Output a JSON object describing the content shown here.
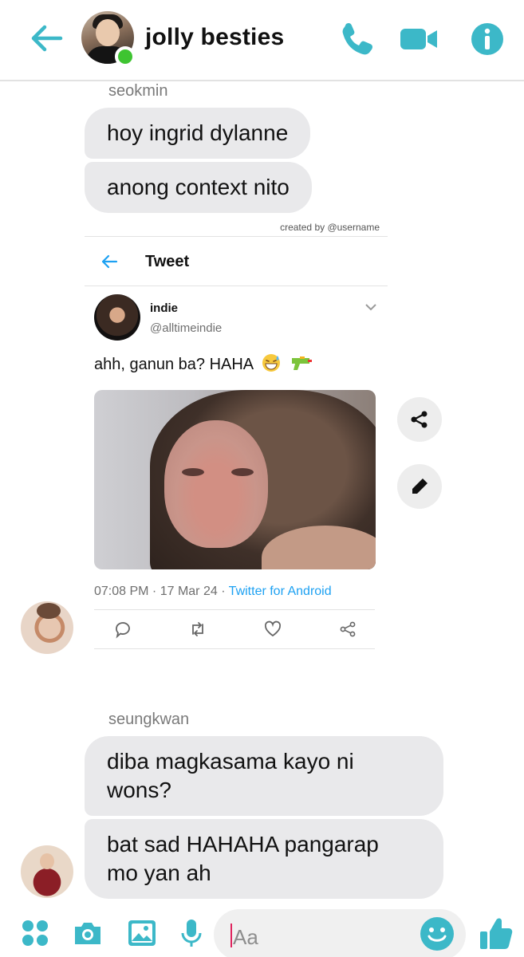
{
  "colors": {
    "accent": "#3cb8c8",
    "bubble": "#e9e9eb",
    "online": "#3ec431",
    "twitter_blue": "#1da1f2"
  },
  "header": {
    "title": "jolly besties",
    "icons": [
      "back-arrow-icon",
      "phone-icon",
      "video-icon",
      "info-icon"
    ]
  },
  "messages": [
    {
      "sender": "seokmin",
      "bubbles": [
        "hoy ingrid dylanne",
        "anong context nito"
      ]
    },
    {
      "sender": "seungkwan",
      "bubbles": [
        "diba magkasama kayo ni\nwons?",
        "bat sad HAHAHA pangarap\nmo yan ah"
      ]
    }
  ],
  "tweet_card": {
    "credit": "created by @username",
    "header_title": "Tweet",
    "author_name": "indie",
    "author_handle": "@alltimeindie",
    "text": "ahh, ganun ba? HAHA",
    "emojis": [
      "grinning-sweat-emoji",
      "water-pistol-emoji"
    ],
    "meta_time": "07:08 PM · 17 Mar 24 · ",
    "meta_source": "Twitter for Android",
    "actions": [
      "reply-icon",
      "retweet-icon",
      "like-icon",
      "share-icon"
    ]
  },
  "side_buttons": [
    "share-icon",
    "pencil-icon"
  ],
  "composer": {
    "placeholder": "Aa",
    "icons": [
      "apps-icon",
      "camera-icon",
      "gallery-icon",
      "microphone-icon",
      "emoji-icon",
      "like-thumb-icon"
    ]
  }
}
